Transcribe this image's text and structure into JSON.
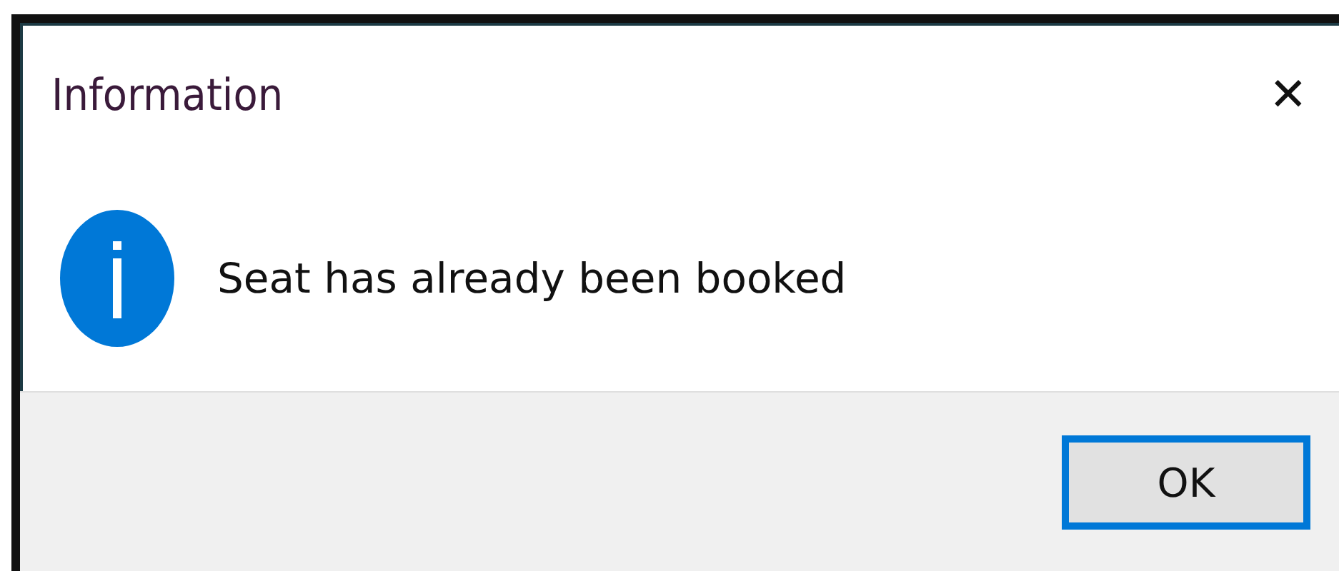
{
  "window": {
    "title": "Information",
    "close": "✕"
  },
  "message": "Seat has already been booked",
  "buttons": [
    {
      "label": "OK",
      "selected": true
    }
  ]
}
